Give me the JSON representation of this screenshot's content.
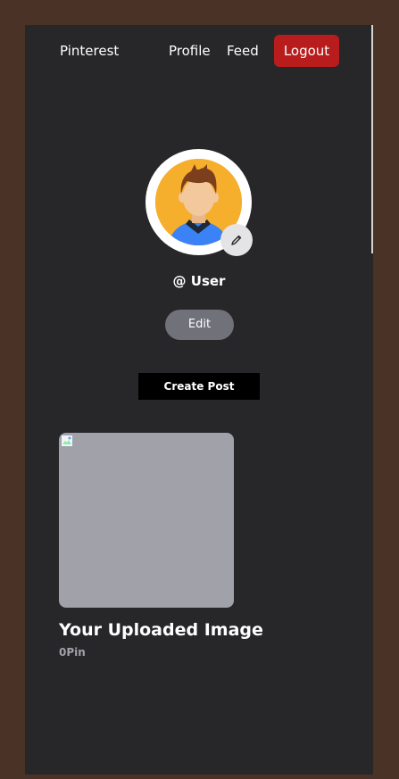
{
  "nav": {
    "brand": "Pinterest",
    "links": [
      "Profile",
      "Feed"
    ],
    "logout_label": "Logout"
  },
  "profile": {
    "avatar_icon": "user-avatar-illustration",
    "edit_icon": "pencil-icon",
    "username": "@ User",
    "edit_label": "Edit"
  },
  "actions": {
    "create_post_label": "Create Post"
  },
  "posts": [
    {
      "title": "Your Uploaded Image",
      "pins": "0Pin"
    }
  ],
  "colors": {
    "page_bg": "#4a3326",
    "panel_bg": "#27272a",
    "logout_bg": "#b91c1c",
    "edit_bg": "#71717a",
    "create_post_bg": "#000000",
    "card_bg": "#a1a1aa",
    "avatar_bg": "#f6ae2d"
  }
}
